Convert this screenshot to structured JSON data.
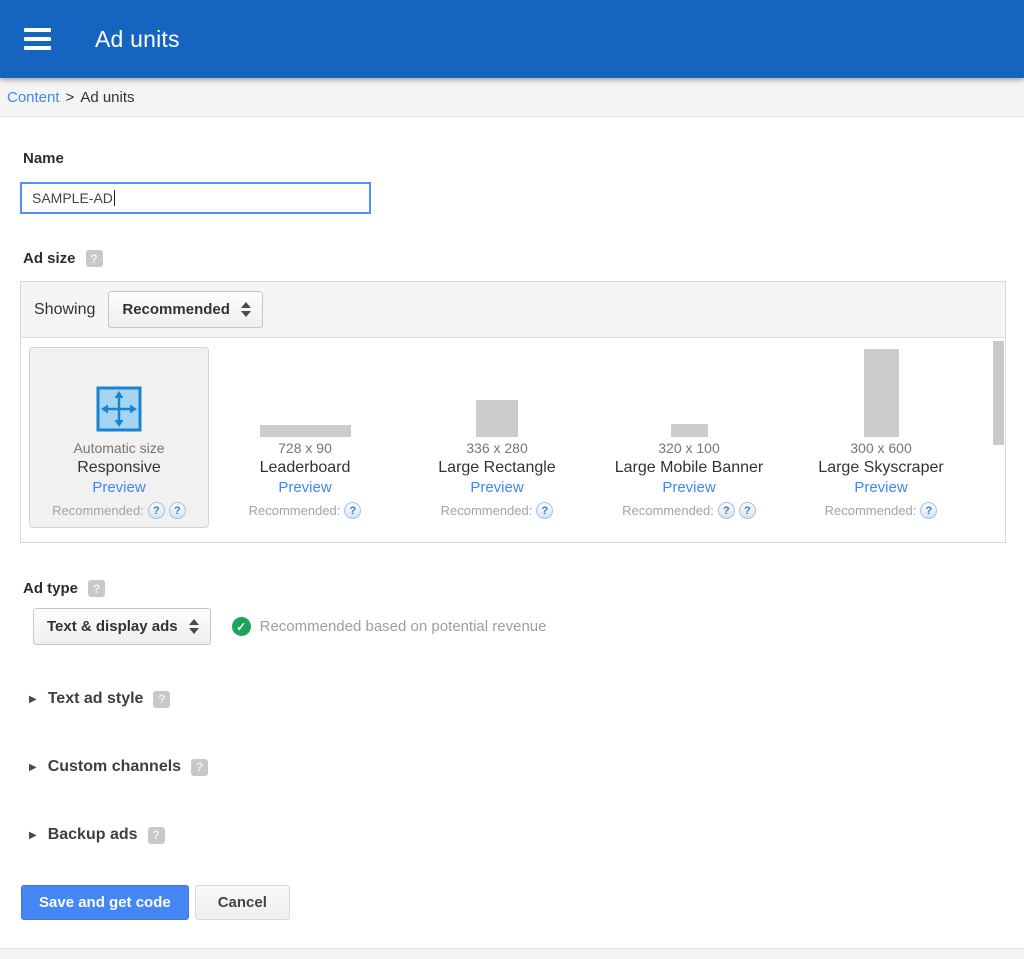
{
  "header": {
    "title": "Ad units"
  },
  "breadcrumb": {
    "link": "Content",
    "separator": ">",
    "current": "Ad units"
  },
  "name_field": {
    "label": "Name",
    "value": "SAMPLE-AD"
  },
  "ad_size": {
    "label": "Ad size",
    "showing_label": "Showing",
    "filter_value": "Recommended",
    "cards": [
      {
        "size": "Automatic size",
        "name": "Responsive",
        "preview": "Preview",
        "recommended": "Recommended:"
      },
      {
        "size": "728 x 90",
        "name": "Leaderboard",
        "preview": "Preview",
        "recommended": "Recommended:"
      },
      {
        "size": "336 x 280",
        "name": "Large Rectangle",
        "preview": "Preview",
        "recommended": "Recommended:"
      },
      {
        "size": "320 x 100",
        "name": "Large Mobile Banner",
        "preview": "Preview",
        "recommended": "Recommended:"
      },
      {
        "size": "300 x 600",
        "name": "Large Skyscraper",
        "preview": "Preview",
        "recommended": "Recommended:"
      }
    ]
  },
  "ad_type": {
    "label": "Ad type",
    "value": "Text & display ads",
    "hint": "Recommended based on potential revenue"
  },
  "sections": [
    {
      "label": "Text ad style"
    },
    {
      "label": "Custom channels"
    },
    {
      "label": "Backup ads"
    }
  ],
  "actions": {
    "save": "Save and get code",
    "cancel": "Cancel"
  },
  "icons": {
    "question_badge": "?",
    "help": "?",
    "check": "✓",
    "collapsed_caret": "▶"
  },
  "colors": {
    "header_blue": "#1565c0",
    "link_blue": "#4285f4",
    "save_blue": "#4486f3",
    "success_green": "#1ca45c",
    "focus_border": "#4d90fe",
    "mock_gray": "#cccccc",
    "responsive_icon_fill": "#a6d4f3",
    "responsive_icon_stroke": "#1b84d1"
  }
}
